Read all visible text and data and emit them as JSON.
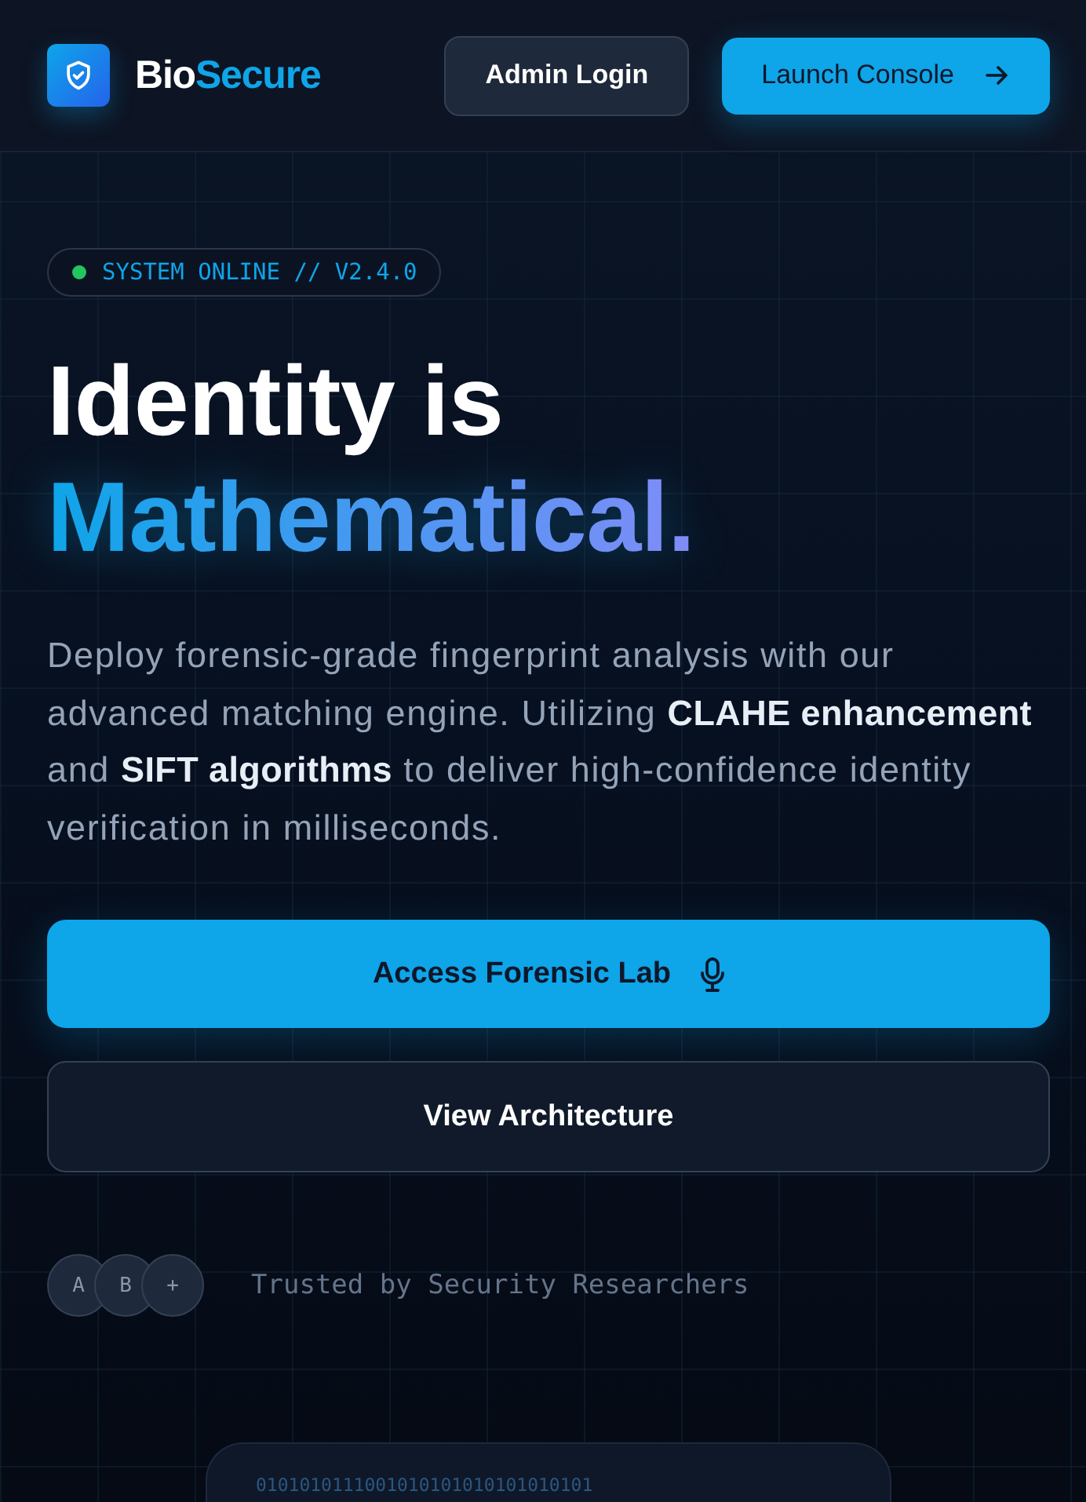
{
  "header": {
    "brand": {
      "part_1": "Bio",
      "part_2": "Secure"
    },
    "buttons": [
      {
        "label": "Admin Login",
        "kind": "secondary"
      },
      {
        "label": "Launch Console",
        "kind": "primary"
      }
    ]
  },
  "hero": {
    "status_badge": {
      "text": "SYSTEM ONLINE // V2.4.0",
      "online": true
    },
    "title_line_1": "Identity is",
    "title_line_2": "Mathematical.",
    "description": "Deploy forensic-grade fingerprint analysis with our advanced matching engine. Utilizing **CLAHE enhancement** and **SIFT algorithms** to deliver high-confidence identity verification in milliseconds.",
    "actions": [
      {
        "label": "Access Forensic Lab",
        "kind": "primary"
      },
      {
        "label": "View Architecture",
        "kind": "secondary"
      }
    ],
    "trust": {
      "avatars": [
        "A",
        "B",
        "+"
      ],
      "text": "Trusted by Security Researchers"
    }
  },
  "preview_card": {
    "code_line": "0101010111001010101010101010101"
  }
}
